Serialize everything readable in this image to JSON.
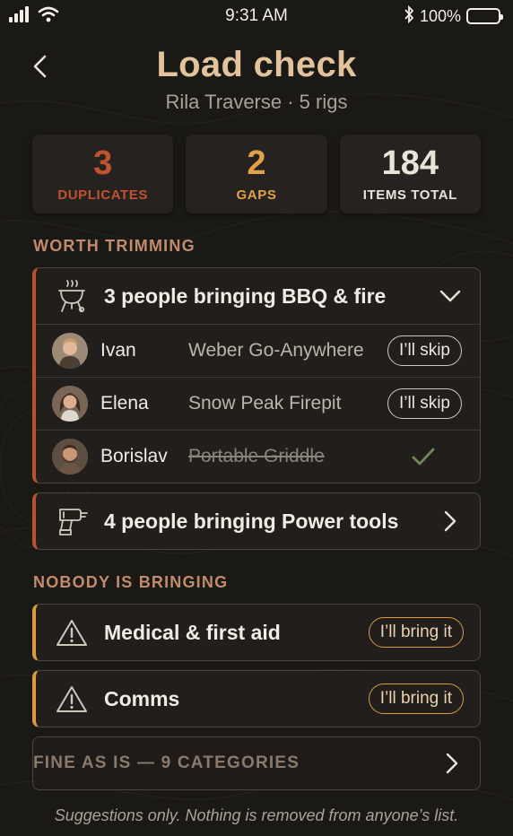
{
  "status_bar": {
    "time": "9:31 AM",
    "battery": "100%"
  },
  "header": {
    "title": "Load check",
    "subtitle": "Rila Traverse · 5 rigs"
  },
  "stats": [
    {
      "value": "3",
      "label": "DUPLICATES"
    },
    {
      "value": "2",
      "label": "GAPS"
    },
    {
      "value": "184",
      "label": "ITEMS TOTAL"
    }
  ],
  "worth_trimming": {
    "label": "WORTH TRIMMING",
    "bbq": {
      "title": "3 people bringing BBQ & fire",
      "rows": [
        {
          "name": "Ivan",
          "item": "Weber Go-Anywhere",
          "action": "I’ll skip"
        },
        {
          "name": "Elena",
          "item": "Snow Peak Firepit",
          "action": "I’ll skip"
        },
        {
          "name": "Borislav",
          "item": "Portable Griddle"
        }
      ]
    },
    "power_tools": {
      "title": "4 people bringing Power tools"
    }
  },
  "nobody_bringing": {
    "label": "NOBODY IS BRINGING",
    "items": [
      {
        "title": "Medical & first aid",
        "action": "I’ll bring it"
      },
      {
        "title": "Comms",
        "action": "I’ll bring it"
      }
    ]
  },
  "fine": {
    "label": "FINE AS IS — 9 CATEGORIES"
  },
  "footnote": "Suggestions only. Nothing is removed from anyone’s list.",
  "colors": {
    "background": "#1b1916",
    "title": "#e2c39b",
    "duplicate": "#c0532f",
    "gap": "#e0a14a",
    "check": "#6f8a55"
  },
  "icons": [
    "signal-icon",
    "wifi-icon",
    "bluetooth-icon",
    "battery-icon",
    "back-icon",
    "grill-icon",
    "drill-icon",
    "warning-icon",
    "chevron-down-icon",
    "chevron-right-icon",
    "check-icon"
  ]
}
